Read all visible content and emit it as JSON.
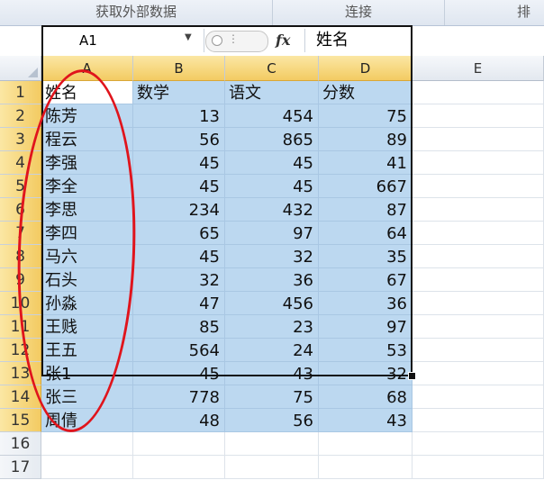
{
  "ribbon": {
    "groups": [
      "获取外部数据",
      "连接",
      "排"
    ]
  },
  "formula_bar": {
    "name_box": "A1",
    "fx_label": "fx",
    "content": "姓名"
  },
  "sheet": {
    "columns": [
      "A",
      "B",
      "C",
      "D",
      "E"
    ],
    "rows": [
      "1",
      "2",
      "3",
      "4",
      "5",
      "6",
      "7",
      "8",
      "9",
      "10",
      "11",
      "12",
      "13",
      "14",
      "15",
      "16",
      "17"
    ],
    "header": [
      "姓名",
      "数学",
      "语文",
      "分数"
    ],
    "data": [
      [
        "陈芳",
        "13",
        "454",
        "75"
      ],
      [
        "程云",
        "56",
        "865",
        "89"
      ],
      [
        "李强",
        "45",
        "45",
        "41"
      ],
      [
        "李全",
        "45",
        "45",
        "667"
      ],
      [
        "李思",
        "234",
        "432",
        "87"
      ],
      [
        "李四",
        "65",
        "97",
        "64"
      ],
      [
        "马六",
        "45",
        "32",
        "35"
      ],
      [
        "石头",
        "32",
        "36",
        "67"
      ],
      [
        "孙淼",
        "47",
        "456",
        "36"
      ],
      [
        "王贱",
        "85",
        "23",
        "97"
      ],
      [
        "王五",
        "564",
        "24",
        "53"
      ],
      [
        "张1",
        "45",
        "43",
        "32"
      ],
      [
        "张三",
        "778",
        "75",
        "68"
      ],
      [
        "周倩",
        "48",
        "56",
        "43"
      ]
    ]
  },
  "colors": {
    "selection_fill": "#bcd8f0",
    "header_highlight": "#f3cb62",
    "annotation": "#e0141c"
  }
}
